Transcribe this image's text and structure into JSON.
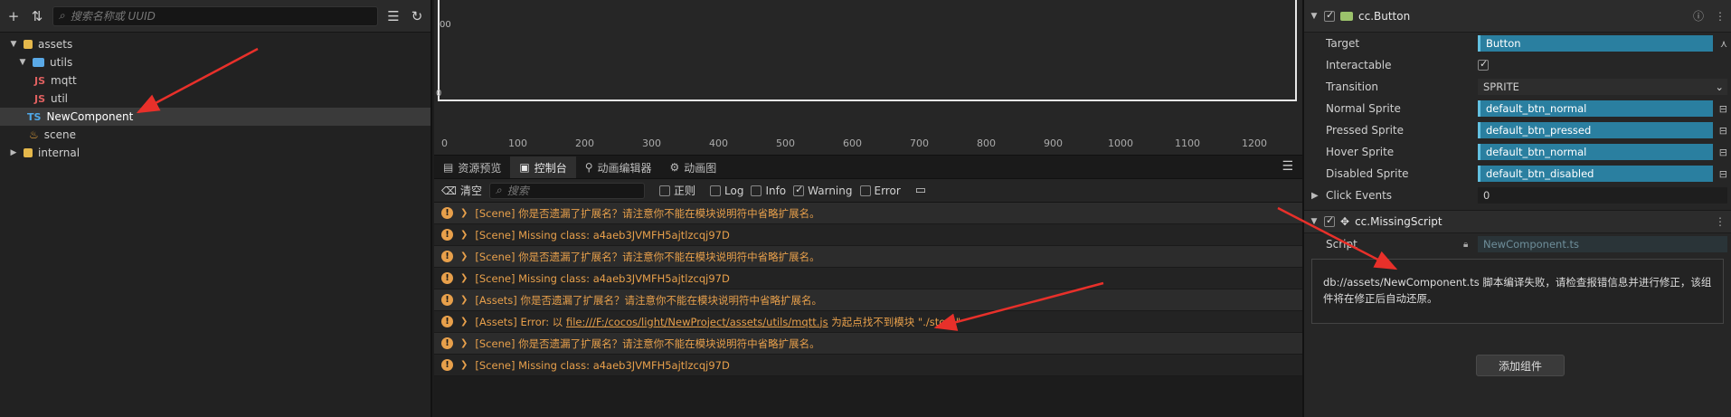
{
  "assets_panel": {
    "search_placeholder": "搜索名称或 UUID",
    "tree": [
      {
        "label": "assets",
        "type": "db"
      },
      {
        "label": "utils",
        "type": "folder"
      },
      {
        "label": "mqtt",
        "type": "js"
      },
      {
        "label": "util",
        "type": "js"
      },
      {
        "label": "NewComponent",
        "type": "ts"
      },
      {
        "label": "scene",
        "type": "scene"
      },
      {
        "label": "internal",
        "type": "db"
      }
    ],
    "badges": {
      "js": "JS",
      "ts": "TS"
    }
  },
  "scene_view": {
    "label_00": "00",
    "label_0": "0",
    "ruler": [
      "0",
      "100",
      "200",
      "300",
      "400",
      "500",
      "600",
      "700",
      "800",
      "900",
      "1000",
      "1100",
      "1200"
    ]
  },
  "tabs": [
    "资源预览",
    "控制台",
    "动画编辑器",
    "动画图"
  ],
  "console_toolbar": {
    "clear": "清空",
    "search_placeholder": "搜索",
    "regex": "正则",
    "log": "Log",
    "info": "Info",
    "warning": "Warning",
    "error": "Error"
  },
  "console_logs": [
    {
      "text": "[Scene] 你是否遗漏了扩展名？请注意你不能在模块说明符中省略扩展名。"
    },
    {
      "text": "[Scene] Missing class: a4aeb3JVMFH5ajtlzcqj97D"
    },
    {
      "text": "[Scene] 你是否遗漏了扩展名？请注意你不能在模块说明符中省略扩展名。"
    },
    {
      "text": "[Scene] Missing class: a4aeb3JVMFH5ajtlzcqj97D"
    },
    {
      "text": "[Assets] 你是否遗漏了扩展名？请注意你不能在模块说明符中省略扩展名。"
    },
    {
      "pre": "[Assets] Error: 以 ",
      "link": "file:///F:/cocos/light/NewProject/assets/utils/mqtt.js",
      "post": " 为起点找不到模块 \"./store\""
    },
    {
      "text": "[Scene] 你是否遗漏了扩展名？请注意你不能在模块说明符中省略扩展名。"
    },
    {
      "text": "[Scene] Missing class: a4aeb3JVMFH5ajtlzcqj97D"
    }
  ],
  "inspector": {
    "button_title": "cc.Button",
    "props": [
      {
        "label": "Target",
        "value": "Button",
        "kind": "asset",
        "icon": "node-link"
      },
      {
        "label": "Interactable",
        "value": "",
        "kind": "check"
      },
      {
        "label": "Transition",
        "value": "SPRITE",
        "kind": "select"
      },
      {
        "label": "Normal Sprite",
        "value": "default_btn_normal",
        "kind": "asset",
        "icon": "lock"
      },
      {
        "label": "Pressed Sprite",
        "value": "default_btn_pressed",
        "kind": "asset",
        "icon": "lock"
      },
      {
        "label": "Hover Sprite",
        "value": "default_btn_normal",
        "kind": "asset",
        "icon": "lock"
      },
      {
        "label": "Disabled Sprite",
        "value": "default_btn_disabled",
        "kind": "asset",
        "icon": "lock"
      },
      {
        "label": "Click Events",
        "value": "0",
        "kind": "text"
      }
    ],
    "missing_title": "cc.MissingScript",
    "script_label": "Script",
    "script_value": "NewComponent.ts",
    "message": "db://assets/NewComponent.ts 脚本编译失败，请检查报错信息并进行修正，该组件将在修正后自动还原。",
    "add_component": "添加组件"
  },
  "colors": {
    "accent": "#2a7fa0",
    "warning": "#e8a04b",
    "arrow": "#e8302a"
  }
}
